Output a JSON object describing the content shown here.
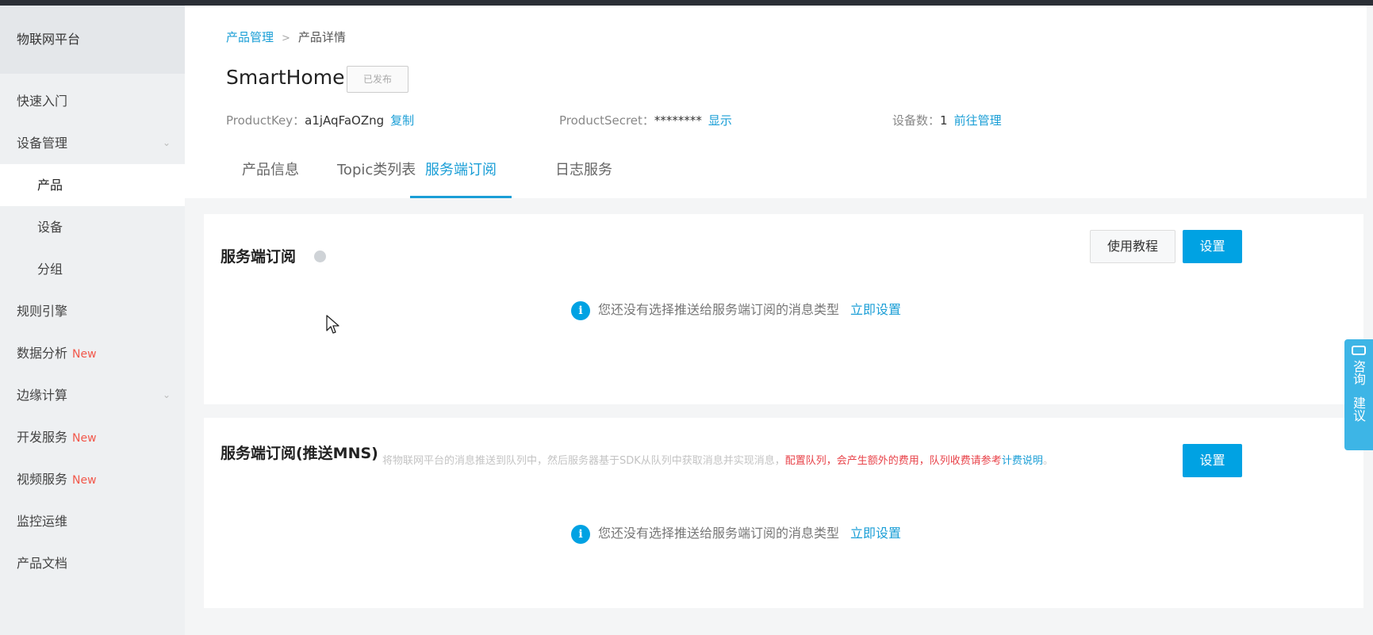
{
  "sidebar": {
    "title": "物联网平台",
    "items": [
      {
        "label": "快速入门",
        "new": "",
        "chevron": ""
      },
      {
        "label": "设备管理",
        "new": "",
        "chevron": "⌄"
      },
      {
        "label": "产品",
        "new": "",
        "chevron": ""
      },
      {
        "label": "设备",
        "new": "",
        "chevron": ""
      },
      {
        "label": "分组",
        "new": "",
        "chevron": ""
      },
      {
        "label": "规则引擎",
        "new": "",
        "chevron": ""
      },
      {
        "label": "数据分析",
        "new": "New",
        "chevron": ""
      },
      {
        "label": "边缘计算",
        "new": "",
        "chevron": "⌄"
      },
      {
        "label": "开发服务",
        "new": "New",
        "chevron": ""
      },
      {
        "label": "视频服务",
        "new": "New",
        "chevron": ""
      },
      {
        "label": "监控运维",
        "new": "",
        "chevron": ""
      },
      {
        "label": "产品文档",
        "new": "",
        "chevron": ""
      }
    ]
  },
  "breadcrumb": {
    "parent": "产品管理",
    "separator": ">",
    "current": "产品详情"
  },
  "product": {
    "name": "SmartHome",
    "badge": "已发布",
    "key_label": "ProductKey：",
    "key_value": "a1jAqFaOZng",
    "key_action": "复制",
    "secret_label": "ProductSecret：",
    "secret_value": "********",
    "secret_action": "显示",
    "devices_label": "设备数：",
    "devices_value": "1",
    "devices_action": "前往管理"
  },
  "tabs": [
    "产品信息",
    "Topic类列表",
    "服务端订阅",
    "日志服务"
  ],
  "active_tab": "服务端订阅",
  "section1": {
    "title": "服务端订阅",
    "tutorial_button": "使用教程",
    "settings_button": "设置",
    "empty_text": "您还没有选择推送给服务端订阅的消息类型",
    "empty_link": "立即设置"
  },
  "section2": {
    "title": "服务端订阅(推送MNS)",
    "description": "将物联网平台的消息推送到队列中，然后服务器基于SDK从队列中获取消息并实现消息，",
    "description_warning": "配置队列，会产生额外的费用，队列收费请参考",
    "description_link": "计费说明",
    "description_end": "。",
    "settings_button": "设置",
    "empty_text": "您还没有选择推送给服务端订阅的消息类型",
    "empty_link": "立即设置"
  },
  "float_help": {
    "label_top": "咨询",
    "label_bottom": "建议"
  },
  "colors": {
    "accent": "#00a2e3",
    "link": "#1a9ed6",
    "new_badge": "#f2584b",
    "warning": "#e8434a"
  }
}
